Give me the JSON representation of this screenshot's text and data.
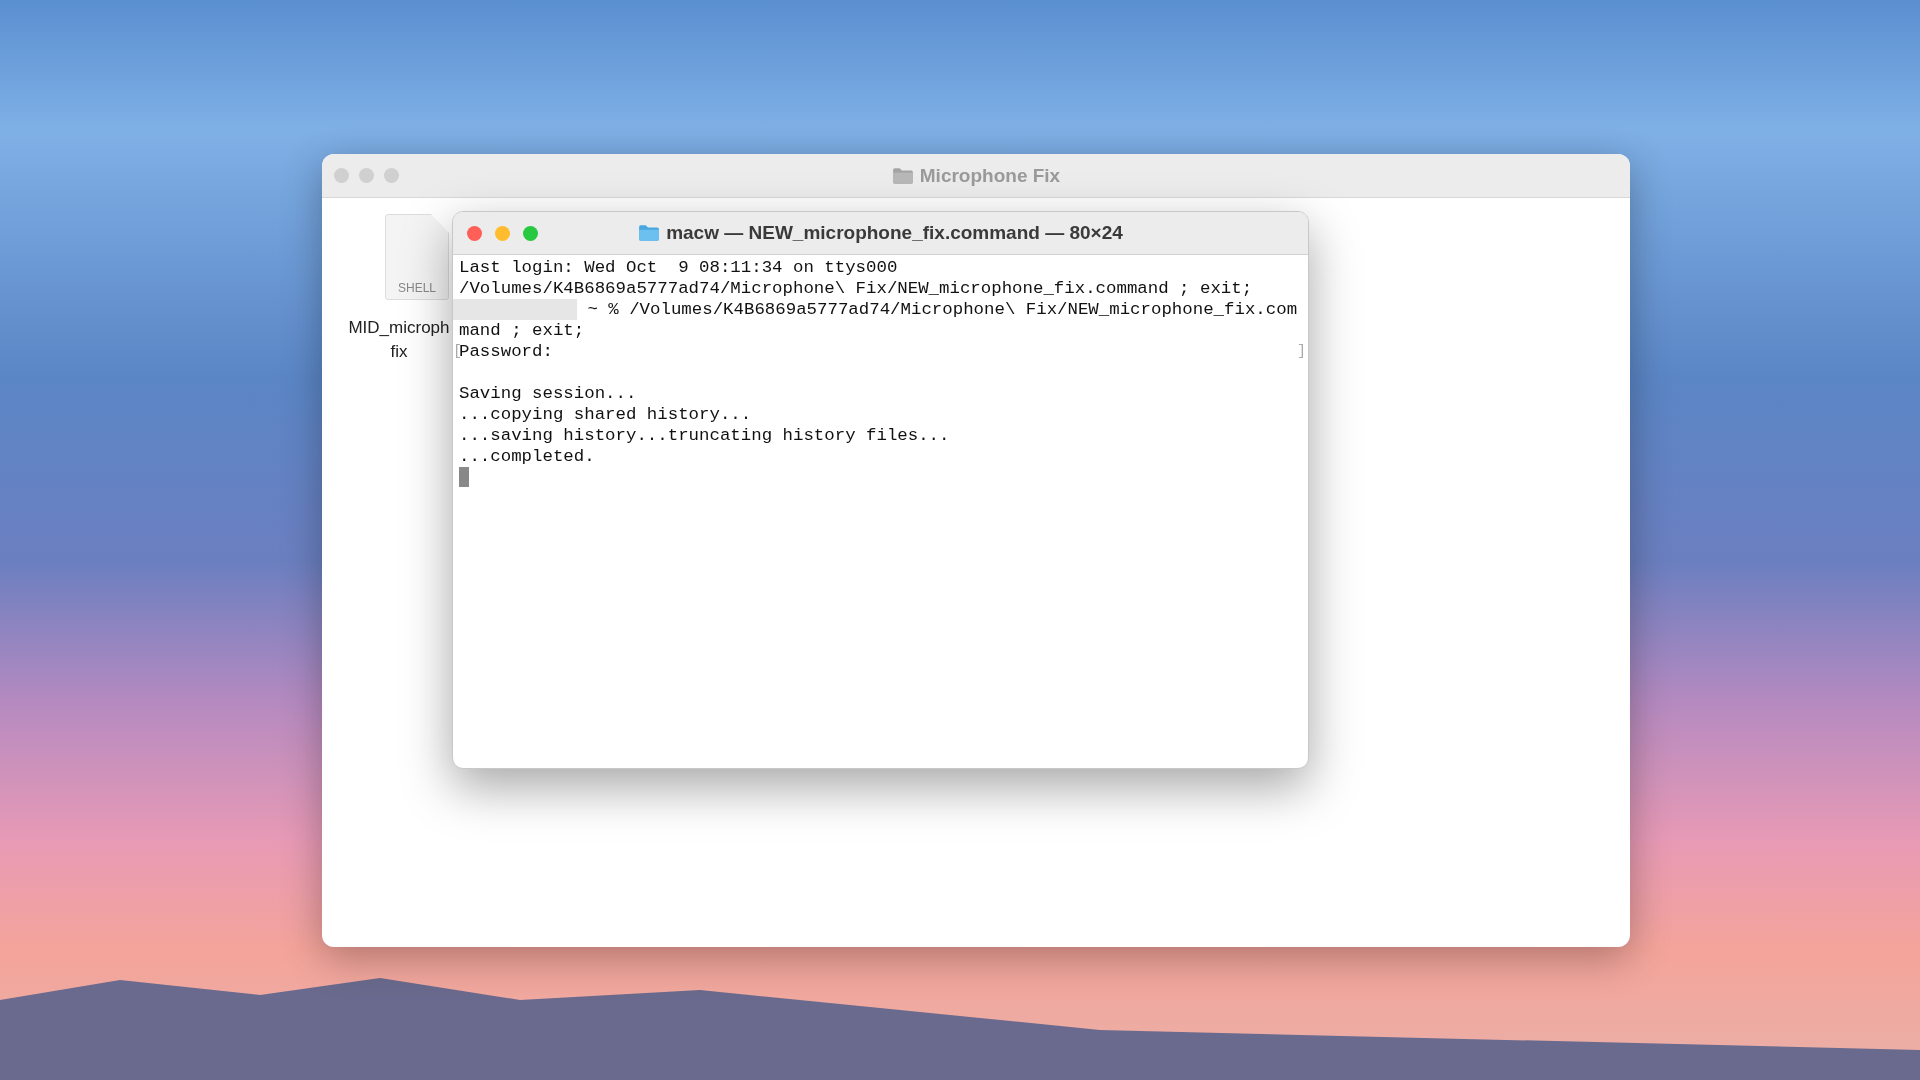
{
  "finder_window": {
    "title": "Microphone Fix",
    "active": false,
    "file": {
      "badge": "SHELL",
      "label_lines": [
        "MID_microph",
        "fix"
      ]
    }
  },
  "terminal_window": {
    "title": "macw — NEW_microphone_fix.command — 80×24",
    "active": true,
    "lines": [
      {
        "kind": "text",
        "text": "Last login: Wed Oct  9 08:11:34 on ttys000"
      },
      {
        "kind": "text",
        "text": "/Volumes/K4B6869a5777ad74/Microphone\\ Fix/NEW_microphone_fix.command ; exit;"
      },
      {
        "kind": "redacted",
        "text": "~ % /Volumes/K4B6869a5777ad74/Microphone\\ Fix/NEW_microphone_fix.com"
      },
      {
        "kind": "text",
        "text": "mand ; exit;"
      },
      {
        "kind": "marked",
        "text": "Password:",
        "left_mark": "[",
        "right_mark": "]"
      },
      {
        "kind": "blank"
      },
      {
        "kind": "text",
        "text": "Saving session..."
      },
      {
        "kind": "text",
        "text": "...copying shared history..."
      },
      {
        "kind": "text",
        "text": "...saving history...truncating history files..."
      },
      {
        "kind": "text",
        "text": "...completed."
      },
      {
        "kind": "cursor"
      }
    ]
  }
}
